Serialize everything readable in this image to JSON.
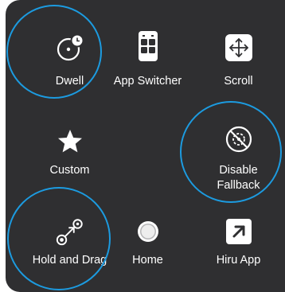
{
  "menu": {
    "items": [
      {
        "label": "Dwell",
        "icon": "dwell-icon"
      },
      {
        "label": "App Switcher",
        "icon": "app-switcher-icon"
      },
      {
        "label": "Scroll",
        "icon": "scroll-arrows-icon"
      },
      {
        "label": "Custom",
        "icon": "star-icon"
      },
      {
        "label": "",
        "icon": "blank"
      },
      {
        "label": "Disable Fallback",
        "icon": "disable-fallback-icon"
      },
      {
        "label": "Hold and Drag",
        "icon": "hold-and-drag-icon"
      },
      {
        "label": "Home",
        "icon": "home-button-icon"
      },
      {
        "label": "Hiru App",
        "icon": "hiru-app-icon"
      }
    ]
  },
  "colors": {
    "panel": "#2f2f31",
    "highlight_ring": "#1c9be0",
    "text": "#ffffff"
  }
}
